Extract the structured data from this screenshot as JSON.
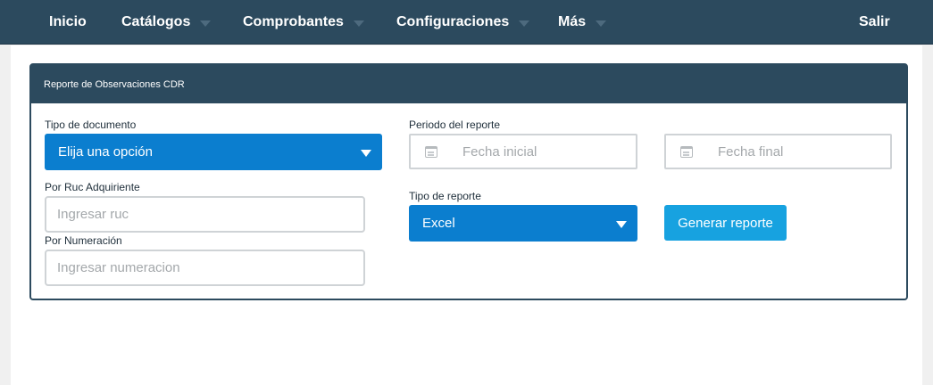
{
  "nav": {
    "items": [
      {
        "label": "Inicio",
        "dropdown": false
      },
      {
        "label": "Catálogos",
        "dropdown": true
      },
      {
        "label": "Comprobantes",
        "dropdown": true
      },
      {
        "label": "Configuraciones",
        "dropdown": true
      },
      {
        "label": "Más",
        "dropdown": true
      }
    ],
    "logout_label": "Salir"
  },
  "panel": {
    "title": "Reporte de Observaciones CDR"
  },
  "form": {
    "document_type": {
      "label": "Tipo de documento",
      "selected": "Elija una opción"
    },
    "ruc": {
      "label": "Por Ruc Adquiriente",
      "placeholder": "Ingresar ruc",
      "value": ""
    },
    "numeracion": {
      "label": "Por Numeración",
      "placeholder": "Ingresar numeracion",
      "value": ""
    },
    "period": {
      "label": "Periodo del reporte",
      "start_placeholder": "Fecha inicial",
      "end_placeholder": "Fecha final"
    },
    "report_type": {
      "label": "Tipo de reporte",
      "selected": "Excel"
    },
    "generate_label": "Generar reporte"
  },
  "colors": {
    "navbar": "#2c4a5e",
    "select_blue": "#0b7ecf",
    "button_blue": "#17a2e0",
    "input_border": "#cfd3d6"
  },
  "icons": {
    "date_icon": "calendar-icon",
    "select_icon": "caret-down-icon"
  }
}
